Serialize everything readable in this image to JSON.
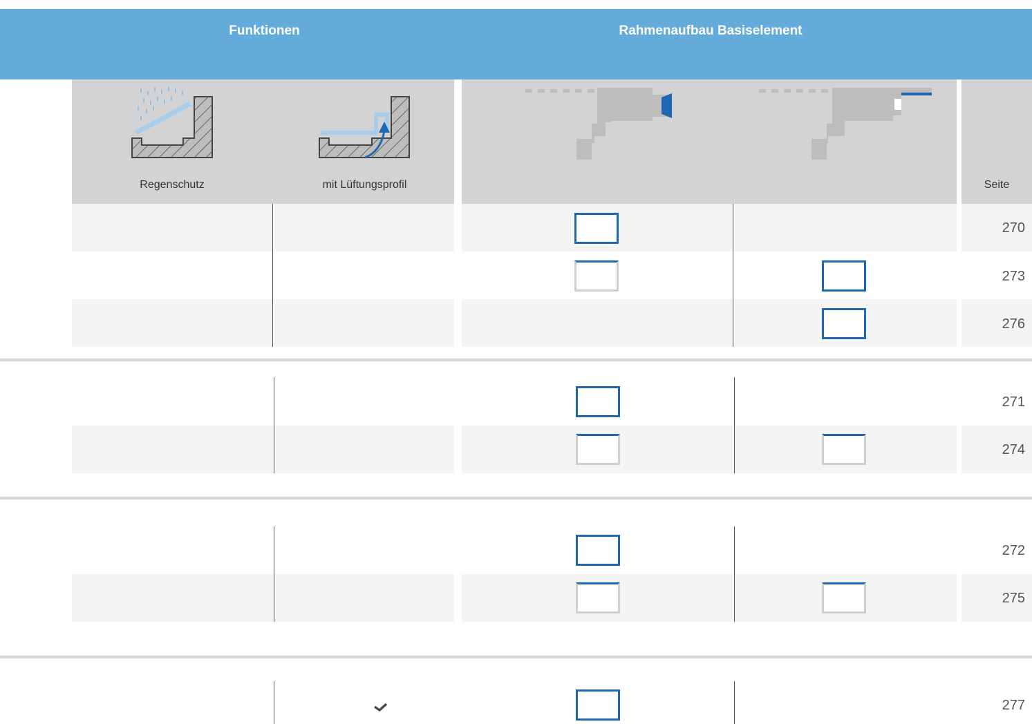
{
  "header": {
    "functions_title": "Funktionen",
    "frame_title": "Rahmenaufbau Basiselement",
    "color": "#64abdc"
  },
  "columns": {
    "rain_label": "Regenschutz",
    "vent_label": "mit Lüftungsprofil",
    "page_label": "Seite",
    "icons": [
      "rain-protection-icon",
      "ventilation-profile-icon",
      "frame-profile-a-icon",
      "frame-profile-b-icon"
    ]
  },
  "groups": [
    {
      "rows": [
        {
          "page": "270",
          "frame_a": "full",
          "frame_b": "none"
        },
        {
          "page": "273",
          "frame_a": "partial",
          "frame_b": "full"
        },
        {
          "page": "276",
          "frame_a": "none",
          "frame_b": "full"
        }
      ]
    },
    {
      "rows": [
        {
          "page": "271",
          "frame_a": "full",
          "frame_b": "none"
        },
        {
          "page": "274",
          "frame_a": "partial",
          "frame_b": "partial"
        }
      ]
    },
    {
      "rows": [
        {
          "page": "272",
          "frame_a": "full",
          "frame_b": "none"
        },
        {
          "page": "275",
          "frame_a": "partial",
          "frame_b": "partial"
        }
      ]
    },
    {
      "rows": [
        {
          "page": "277",
          "frame_a": "full",
          "frame_b": "none",
          "ventilation_check": true,
          "check_icon": "checkmark-icon"
        }
      ]
    }
  ],
  "colors": {
    "accent_blue": "#1f68b1",
    "light_blue": "#a8cdea",
    "panel_gray": "#d3d3d3",
    "stripe": "#f4f4f4"
  }
}
